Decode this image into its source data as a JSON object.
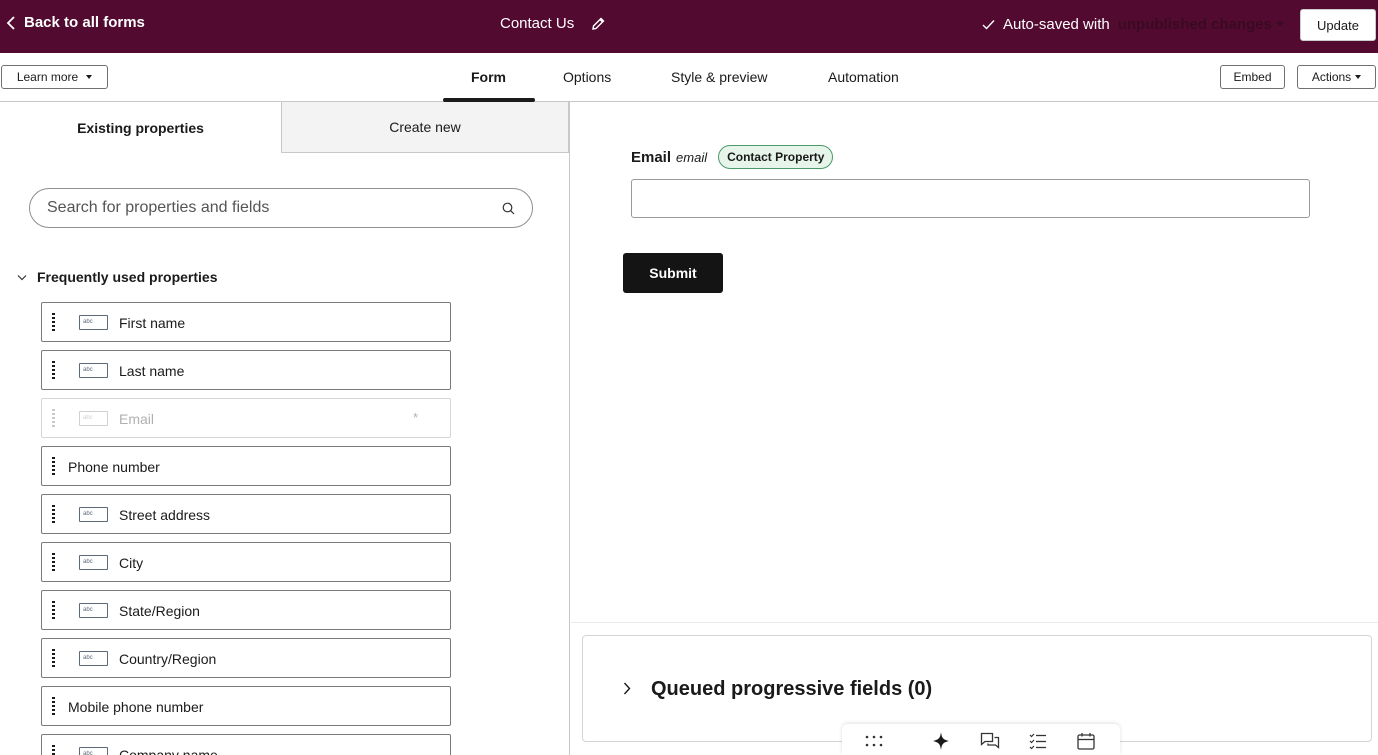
{
  "topbar": {
    "back_label": "Back to all forms",
    "form_title": "Contact Us",
    "autosave_prefix": "Auto-saved with",
    "autosave_status": "unpublished changes",
    "update_label": "Update"
  },
  "nav": {
    "learn_more": "Learn more",
    "tabs": [
      {
        "label": "Form",
        "active": true
      },
      {
        "label": "Options",
        "active": false
      },
      {
        "label": "Style & preview",
        "active": false
      },
      {
        "label": "Automation",
        "active": false
      }
    ],
    "embed": "Embed",
    "actions": "Actions"
  },
  "left_panel": {
    "tabs": [
      "Existing properties",
      "Create new"
    ],
    "search_placeholder": "Search for properties and fields",
    "section_title": "Frequently used properties",
    "properties": [
      {
        "label": "First name",
        "icon": "abc",
        "disabled": false
      },
      {
        "label": "Last name",
        "icon": "abc",
        "disabled": false
      },
      {
        "label": "Email",
        "icon": "abc",
        "disabled": true,
        "required_mark": "*"
      },
      {
        "label": "Phone number",
        "icon": "",
        "disabled": false
      },
      {
        "label": "Street address",
        "icon": "abc",
        "disabled": false
      },
      {
        "label": "City",
        "icon": "abc",
        "disabled": false
      },
      {
        "label": "State/Region",
        "icon": "abc",
        "disabled": false
      },
      {
        "label": "Country/Region",
        "icon": "abc",
        "disabled": false
      },
      {
        "label": "Mobile phone number",
        "icon": "",
        "disabled": false
      },
      {
        "label": "Company name",
        "icon": "abc",
        "disabled": false
      }
    ]
  },
  "form": {
    "field_label": "Email",
    "field_internal_name": "email",
    "badge": "Contact Property",
    "submit_label": "Submit"
  },
  "queued": {
    "title": "Queued progressive fields (0)"
  },
  "colors": {
    "topbar_bg": "#520a30",
    "badge_bg": "#e6f4ea",
    "badge_border": "#4b9a6b",
    "submit_bg": "#141414"
  }
}
